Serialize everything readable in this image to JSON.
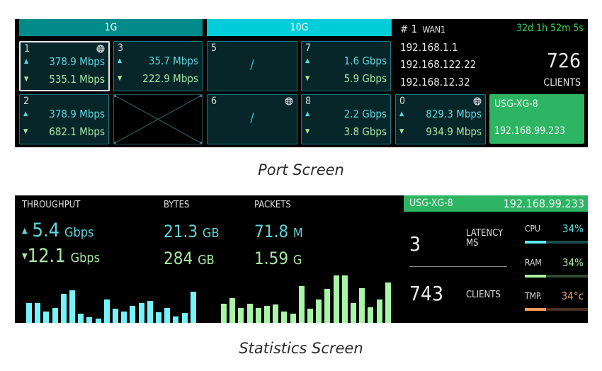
{
  "captions": {
    "port": "Port Screen",
    "stats": "Statistics Screen"
  },
  "port_screen": {
    "headers": {
      "g1": "1G",
      "g10": "10G"
    },
    "ports": {
      "p1": {
        "num": "1",
        "up": "378.9 Mbps",
        "down": "535.1 Mbps",
        "wan": true,
        "selected": true
      },
      "p3": {
        "num": "3",
        "up": "35.7 Mbps",
        "down": "222.9 Mbps"
      },
      "p2": {
        "num": "2",
        "up": "378.9 Mbps",
        "down": "682.1 Mbps"
      },
      "p5": {
        "num": "5",
        "status": "/"
      },
      "p6": {
        "num": "6",
        "status": "/",
        "wan": true
      },
      "p7": {
        "num": "7",
        "up": "1.6 Gbps",
        "down": "5.9 Gbps"
      },
      "p8": {
        "num": "8",
        "up": "2.2 Gbps",
        "down": "3.8 Gbps"
      },
      "p0": {
        "num": "0",
        "up": "829.3 Mbps",
        "down": "934.9 Mbps",
        "wan": true
      }
    },
    "wan": {
      "index": "# 1",
      "name": "WAN1",
      "uptime": "32d 1h 52m 5s",
      "ips": [
        "192.168.1.1",
        "192.168.122.22",
        "192.168.12.32"
      ],
      "clients_count": "726",
      "clients_label": "CLIENTS"
    },
    "device": {
      "name": "USG-XG-8",
      "ip": "192.168.99.233"
    }
  },
  "stats_screen": {
    "labels": {
      "throughput": "THROUGHPUT",
      "bytes": "BYTES",
      "packets": "PACKETS"
    },
    "throughput": {
      "up_value": "5.4",
      "up_unit": "Gbps",
      "down_value": "12.1",
      "down_unit": "Gbps"
    },
    "bytes": {
      "up_value": "21.3",
      "up_unit": "GB",
      "down_value": "284",
      "down_unit": "GB"
    },
    "packets": {
      "up_value": "71.8",
      "up_unit": "M",
      "down_value": "1.59",
      "down_unit": "G"
    },
    "device": {
      "name": "USG-XG-8",
      "ip": "192.168.99.233"
    },
    "latency": {
      "value": "3",
      "label_line1": "LATENCY",
      "label_line2": "MS"
    },
    "clients": {
      "value": "743",
      "label": "CLIENTS"
    },
    "meters": [
      {
        "label": "CPU",
        "value": "34%",
        "fraction": 0.34,
        "color": "#5ee8f0",
        "track": "#1f4a4c",
        "text_color": "#5fd6dc"
      },
      {
        "label": "RAM",
        "value": "34%",
        "fraction": 0.34,
        "color": "#a8f0a0",
        "track": "#2f4a30",
        "text_color": "#a8e6a3"
      },
      {
        "label": "TMP.",
        "value": "34°c",
        "fraction": 0.34,
        "color": "#f29a5a",
        "track": "#4a2f22",
        "text_color": "#f0a46a"
      }
    ]
  },
  "chart_data": {
    "type": "bar",
    "series": [
      {
        "name": "throughput-up",
        "color": "#74f4fa",
        "values": [
          28,
          28,
          16,
          21,
          41,
          46,
          13,
          8,
          6,
          33,
          20,
          16,
          24,
          28,
          31,
          15,
          21,
          9,
          14,
          44
        ]
      },
      {
        "name": "throughput-down",
        "color": "#a8f5a8",
        "values": [
          27,
          35,
          21,
          27,
          21,
          24,
          26,
          16,
          13,
          52,
          20,
          33,
          48,
          67,
          67,
          28,
          49,
          22,
          33,
          57
        ]
      }
    ],
    "title": "",
    "xlabel": "",
    "ylabel": "",
    "ylim": [
      0,
      70
    ],
    "grid": false
  },
  "colors": {
    "accent_1g": "#008b8b",
    "accent_10g": "#00cdda",
    "status_green": "#2db563",
    "uptime": "#3ad35a"
  }
}
